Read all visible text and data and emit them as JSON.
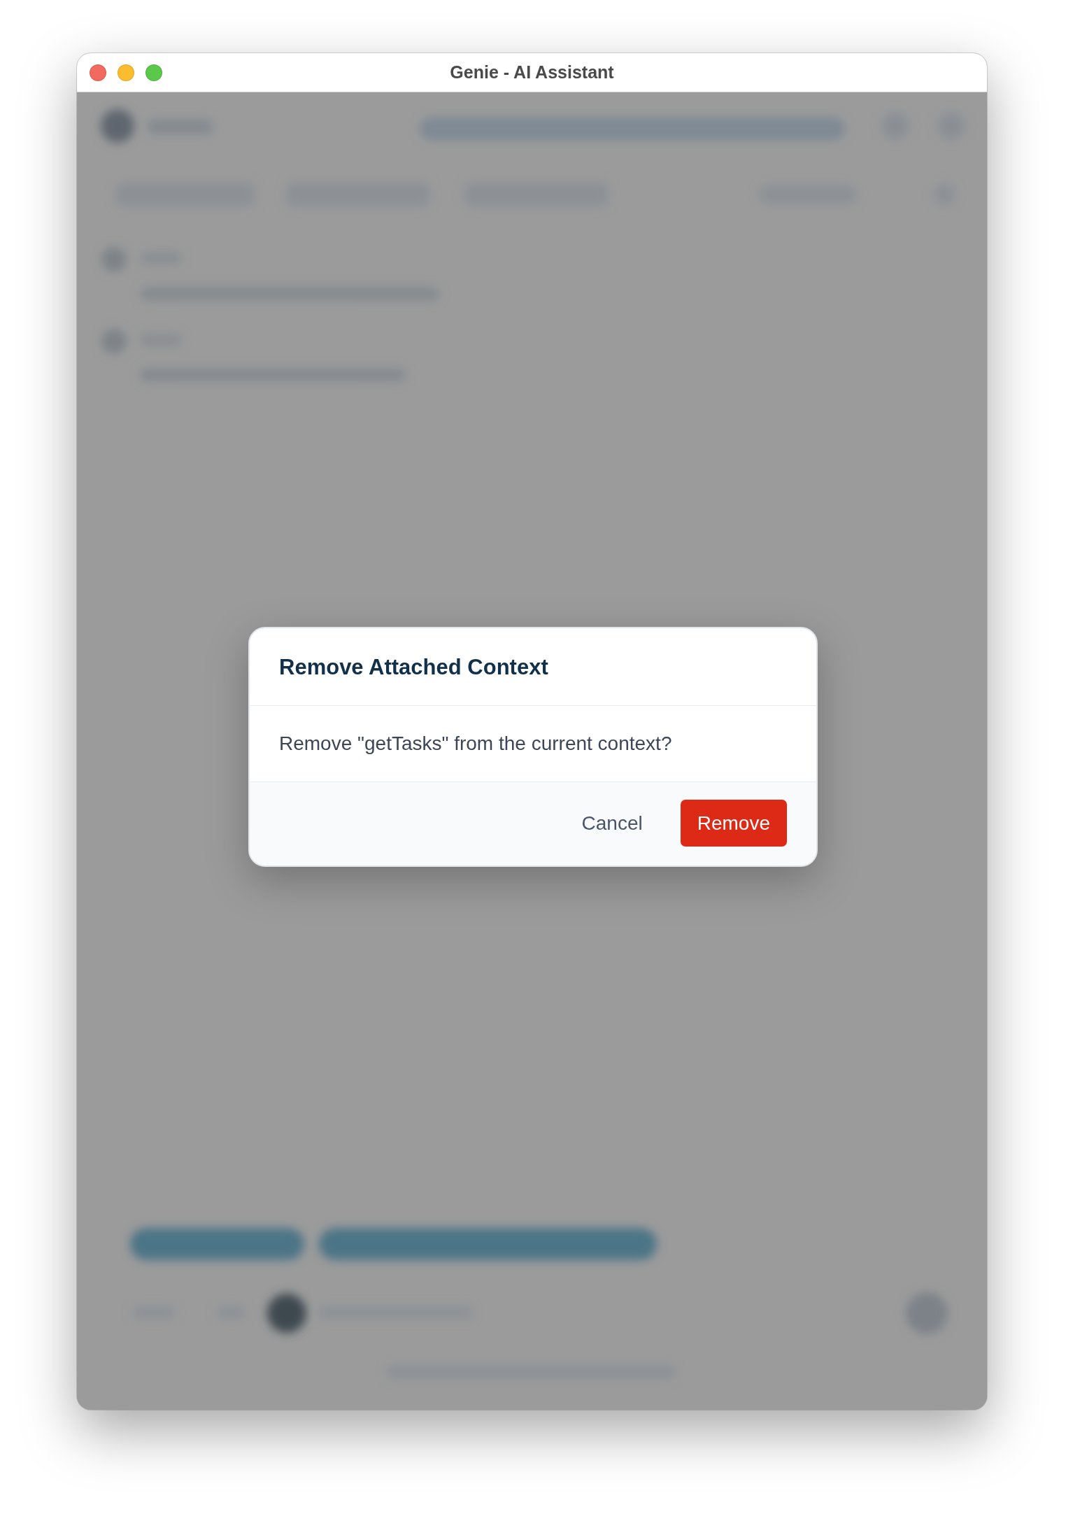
{
  "window": {
    "title": "Genie - AI Assistant"
  },
  "dialog": {
    "title": "Remove Attached Context",
    "message": "Remove \"getTasks\" from the current context?",
    "buttons": [
      {
        "label": "Cancel",
        "kind": "secondary"
      },
      {
        "label": "Remove",
        "kind": "danger"
      }
    ]
  }
}
